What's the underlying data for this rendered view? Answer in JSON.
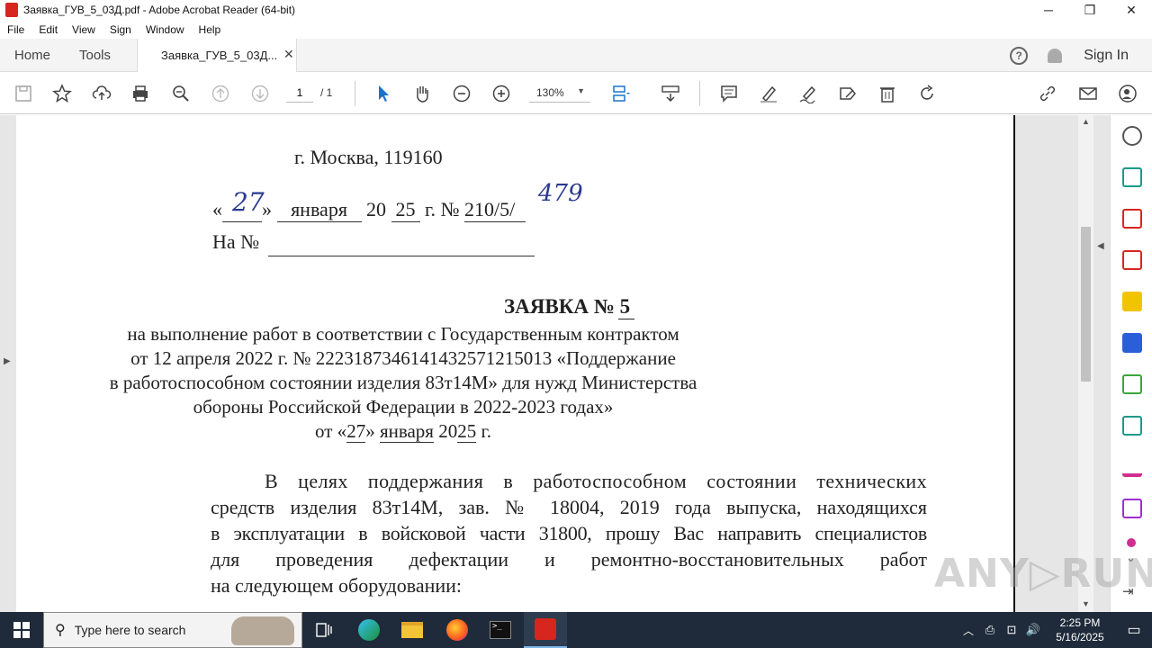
{
  "window": {
    "title": "Заявка_ГУВ_5_03Д.pdf - Adobe Acrobat Reader (64-bit)",
    "minimize": "─",
    "maximize": "❐",
    "close": "✕"
  },
  "menu": [
    "File",
    "Edit",
    "View",
    "Sign",
    "Window",
    "Help"
  ],
  "tabs": {
    "home": "Home",
    "tools": "Tools",
    "document": "Заявка_ГУВ_5_03Д...",
    "close": "✕"
  },
  "header_right": {
    "help": "?",
    "sign_in": "Sign In"
  },
  "toolbar": {
    "page_current": "1",
    "page_total": "/ 1",
    "zoom": "130%",
    "zoom_caret": "▼"
  },
  "document": {
    "address": "г. Москва, 119160",
    "date_open": "«",
    "date_day_hand": "27",
    "date_close": "»",
    "date_month": "января",
    "date_year_prefix": "20",
    "date_year": "25",
    "date_g": "г.",
    "number_label": "№",
    "number": "210/5/",
    "number_hand": "479",
    "na_label": "На №",
    "heading": "ЗАЯВКА № 5",
    "subtitle_lines": [
      "на выполнение работ в соответствии с Государственным контрактом",
      "от 12 апреля 2022 г. № 2223187346141432571215013 «Поддержание",
      "в работоспособном состоянии изделия 83т14М» для нужд Министерства",
      "обороны Российской Федерации в 2022-2023 годах»"
    ],
    "from_date": {
      "prefix": "от «",
      "day": "27",
      "mid": "» ",
      "month": "января",
      "year_prefix": " 20",
      "year": "25",
      "suffix": " г."
    },
    "body_lines": [
      "В целях поддержания в работоспособном состоянии технических",
      "средств изделия 83т14М, зав. № 18004, 2019 года выпуска, находящихся",
      "в эксплуатации в войсковой части 31800, прошу Вас направить специалистов",
      "для проведения дефектации и ремонтно-восстановительных работ",
      "на следующем оборудовании:"
    ]
  },
  "watermark": "ANY▷RUN",
  "taskbar": {
    "search_placeholder": "Type here to search",
    "time": "2:25 PM",
    "date": "5/16/2025"
  },
  "colors": {
    "acrobat_red": "#d7261e",
    "taskbar": "#1f2b3a",
    "accent_blue": "#1a73c9"
  }
}
